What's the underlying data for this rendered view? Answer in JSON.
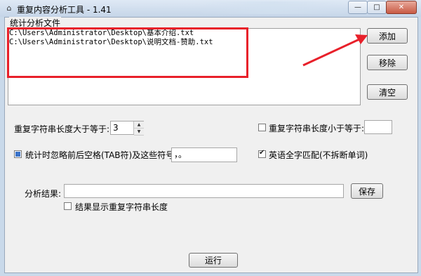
{
  "window": {
    "title": "重复内容分析工具 - 1.41",
    "controls": {
      "minimize": "—",
      "maximize": "□",
      "close": "✕"
    }
  },
  "files_group": {
    "label": "统计分析文件",
    "files": [
      "C:\\Users\\Administrator\\Desktop\\基本介绍.txt",
      "C:\\Users\\Administrator\\Desktop\\说明文档-赞助.txt"
    ]
  },
  "buttons": {
    "add": "添加",
    "remove": "移除",
    "clear": "清空",
    "save": "保存",
    "run": "运行"
  },
  "options": {
    "min_len_label": "重复字符串长度大于等于:",
    "min_len_value": "3",
    "max_len_label": "重复字符串长度小于等于:",
    "max_len_value": "",
    "ignore_label": "统计时忽略前后空格(TAB符)及这些符号:",
    "ignore_value": "，。",
    "english_match_label": "英语全字匹配(不拆断单词)",
    "result_label": "分析结果:",
    "result_value": "",
    "show_len_label": "结果显示重复字符串长度"
  },
  "colors": {
    "annotation": "#e8202a"
  }
}
